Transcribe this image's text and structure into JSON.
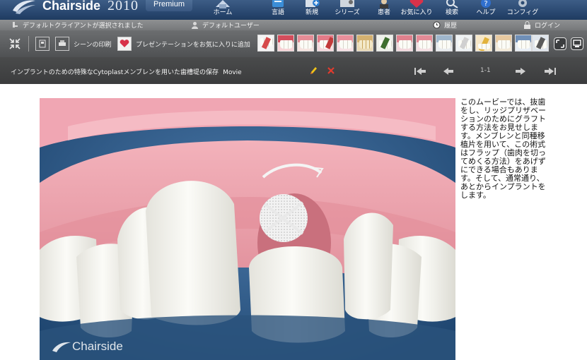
{
  "app": {
    "logo_text": "Chairside",
    "logo_year": "2010",
    "edition_badge": "Premium"
  },
  "nav": {
    "items": [
      {
        "label": "ホーム",
        "icon": "home-icon"
      },
      {
        "label": "言語",
        "icon": "language-icon"
      },
      {
        "label": "新規",
        "icon": "new-icon"
      },
      {
        "label": "シリーズ",
        "icon": "series-icon"
      },
      {
        "label": "患者",
        "icon": "patient-icon"
      },
      {
        "label": "お気に入り",
        "icon": "favorites-icon"
      },
      {
        "label": "検索",
        "icon": "search-icon"
      },
      {
        "label": "ヘルプ",
        "icon": "help-icon"
      },
      {
        "label": "コンフィグ",
        "icon": "config-icon"
      }
    ]
  },
  "status": {
    "client_text": "デフォルトクライアントが選択されました",
    "user_text": "デフォルトユーザー",
    "history_label": "履歴",
    "login_label": "ログイン"
  },
  "toolbar": {
    "print_scene_label": "シーンの印刷",
    "add_favorite_label": "プレゼンテーションをお気に入りに追加"
  },
  "player": {
    "title": "インプラントのための特殊なCytoplastメンブレンを用いた歯槽堤の保存",
    "tag": "Movie",
    "page_indicator": "1-1"
  },
  "content": {
    "description": "このムービーでは、抜歯をし、リッジプリザベーションのためにグラフトする方法をお見せします。メンブレンと同種移植片を用いて、この術式はフラップ（歯肉を切ってめくる方法）をあげずにできる場合もあります。そして、通常通り、あとからインプラントをします。",
    "watermark": "Chairside"
  },
  "colors": {
    "header": "#27456d",
    "toolbar": "#5c5e60",
    "titlebar": "#3f4041",
    "gum": "#e69aa4",
    "tooth": "#f3f3ee",
    "background": "#2d5a87",
    "edit_accent": "#f0c419",
    "delete_accent": "#e23b2e"
  }
}
